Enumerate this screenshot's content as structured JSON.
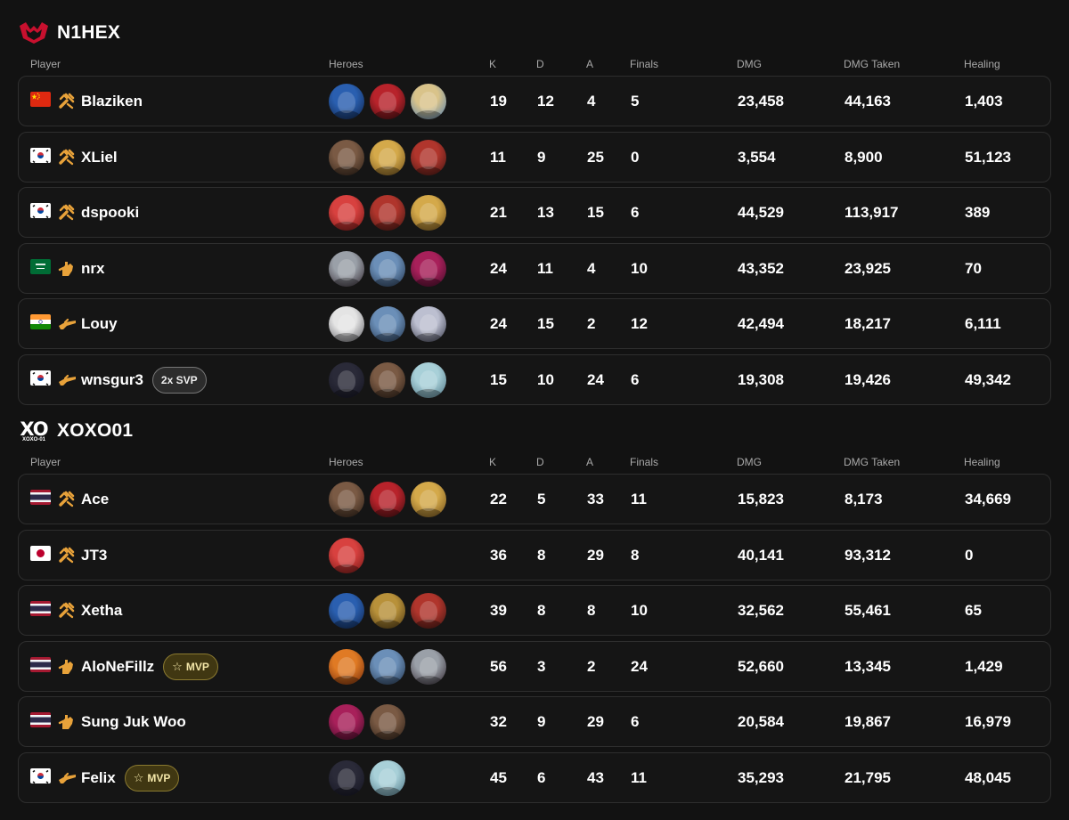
{
  "columns": {
    "player": "Player",
    "heroes": "Heroes",
    "k": "K",
    "d": "D",
    "a": "A",
    "finals": "Finals",
    "dmg": "DMG",
    "dmg_taken": "DMG Taken",
    "healing": "Healing"
  },
  "teams": [
    {
      "name": "N1HEX",
      "logo_icon": "n1hex-logo",
      "players": [
        {
          "flag": "china",
          "role": "strategist",
          "name": "Blaziken",
          "badge": "",
          "heroes": [
            "captain-america",
            "deadpool",
            "invisible-woman"
          ],
          "k": "19",
          "d": "12",
          "a": "4",
          "finals": "5",
          "dmg": "23,458",
          "dmg_taken": "44,163",
          "healing": "1,403"
        },
        {
          "flag": "south-korea",
          "role": "strategist",
          "name": "XLiel",
          "badge": "",
          "heroes": [
            "rocket-raccoon",
            "adam-warlock",
            "doctor-strange"
          ],
          "k": "11",
          "d": "9",
          "a": "25",
          "finals": "0",
          "dmg": "3,554",
          "dmg_taken": "8,900",
          "healing": "51,123"
        },
        {
          "flag": "south-korea",
          "role": "strategist",
          "name": "dspooki",
          "badge": "",
          "heroes": [
            "jeff-the-land-shark",
            "doctor-strange",
            "adam-warlock"
          ],
          "k": "21",
          "d": "13",
          "a": "15",
          "finals": "6",
          "dmg": "44,529",
          "dmg_taken": "113,917",
          "healing": "389"
        },
        {
          "flag": "saudi-arabia",
          "role": "vanguard",
          "name": "nrx",
          "badge": "",
          "heroes": [
            "magik",
            "star-lord",
            "psylocke"
          ],
          "k": "24",
          "d": "11",
          "a": "4",
          "finals": "10",
          "dmg": "43,352",
          "dmg_taken": "23,925",
          "healing": "70"
        },
        {
          "flag": "india",
          "role": "duelist",
          "name": "Louy",
          "badge": "",
          "heroes": [
            "moon-knight",
            "star-lord",
            "black-cat"
          ],
          "k": "24",
          "d": "15",
          "a": "2",
          "finals": "12",
          "dmg": "42,494",
          "dmg_taken": "18,217",
          "healing": "6,111"
        },
        {
          "flag": "south-korea",
          "role": "duelist",
          "name": "wnsgur3",
          "badge": "2x SVP",
          "badge_type": "svp",
          "heroes": [
            "black-widow",
            "rocket-raccoon",
            "luna-snow"
          ],
          "k": "15",
          "d": "10",
          "a": "24",
          "finals": "6",
          "dmg": "19,308",
          "dmg_taken": "19,426",
          "healing": "49,342"
        }
      ]
    },
    {
      "name": "XOXO01",
      "logo_icon": "xoxo01-logo",
      "logo_text": "XO",
      "logo_subtext": "XOXO-01",
      "players": [
        {
          "flag": "thailand",
          "role": "strategist",
          "name": "Ace",
          "badge": "",
          "heroes": [
            "rocket-raccoon",
            "deadpool",
            "adam-warlock"
          ],
          "k": "22",
          "d": "5",
          "a": "33",
          "finals": "11",
          "dmg": "15,823",
          "dmg_taken": "8,173",
          "healing": "34,669"
        },
        {
          "flag": "japan",
          "role": "strategist",
          "name": "JT3",
          "badge": "",
          "heroes": [
            "jeff-the-land-shark"
          ],
          "k": "36",
          "d": "8",
          "a": "29",
          "finals": "8",
          "dmg": "40,141",
          "dmg_taken": "93,312",
          "healing": "0"
        },
        {
          "flag": "thailand",
          "role": "strategist",
          "name": "Xetha",
          "badge": "",
          "heroes": [
            "captain-america",
            "groot",
            "doctor-strange"
          ],
          "k": "39",
          "d": "8",
          "a": "8",
          "finals": "10",
          "dmg": "32,562",
          "dmg_taken": "55,461",
          "healing": "65"
        },
        {
          "flag": "thailand",
          "role": "vanguard",
          "name": "AloNeFillz",
          "badge": "MVP",
          "badge_type": "mvp",
          "heroes": [
            "human-torch",
            "star-lord",
            "magik"
          ],
          "k": "56",
          "d": "3",
          "a": "2",
          "finals": "24",
          "dmg": "52,660",
          "dmg_taken": "13,345",
          "healing": "1,429"
        },
        {
          "flag": "thailand",
          "role": "vanguard",
          "name": "Sung Juk Woo",
          "badge": "",
          "heroes": [
            "psylocke",
            "rocket-raccoon"
          ],
          "k": "32",
          "d": "9",
          "a": "29",
          "finals": "6",
          "dmg": "20,584",
          "dmg_taken": "19,867",
          "healing": "16,979"
        },
        {
          "flag": "south-korea",
          "role": "duelist",
          "name": "Felix",
          "badge": "MVP",
          "badge_type": "mvp",
          "heroes": [
            "black-widow",
            "luna-snow"
          ],
          "k": "45",
          "d": "6",
          "a": "43",
          "finals": "11",
          "dmg": "35,293",
          "dmg_taken": "21,795",
          "healing": "48,045"
        }
      ]
    }
  ],
  "colors": {
    "background": "#121212",
    "row_bg": "#151515",
    "row_border": "#2e2e2e",
    "role_icon": "#e8a23a",
    "team_logo_red": "#c8102e",
    "mvp_badge_bg": "#403712",
    "svp_badge_bg": "#2c2c2c"
  }
}
